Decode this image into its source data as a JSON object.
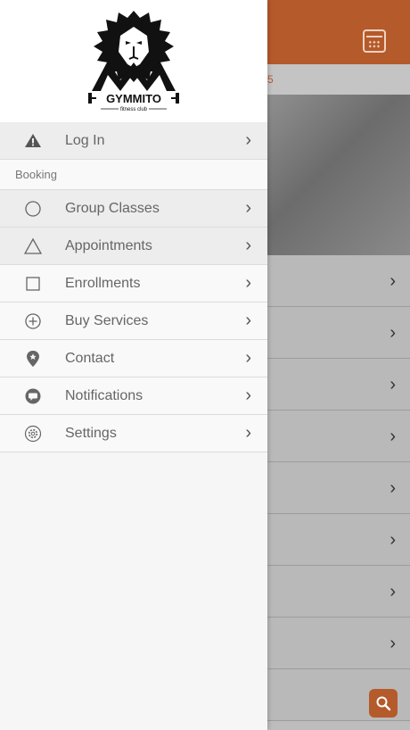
{
  "background": {
    "date_fragment": "5",
    "rows_count_visible": 8
  },
  "brand": {
    "name": "GYMMITO",
    "tagline": "fitness club"
  },
  "menu": {
    "login": {
      "label": "Log In"
    },
    "section_booking": "Booking",
    "items": [
      {
        "label": "Group Classes",
        "icon": "circle-icon"
      },
      {
        "label": "Appointments",
        "icon": "triangle-icon"
      },
      {
        "label": "Enrollments",
        "icon": "square-icon"
      },
      {
        "label": "Buy Services",
        "icon": "plus-circle-icon"
      },
      {
        "label": "Contact",
        "icon": "location-pin-icon"
      },
      {
        "label": "Notifications",
        "icon": "chat-bubble-icon"
      },
      {
        "label": "Settings",
        "icon": "gear-icon"
      }
    ]
  },
  "colors": {
    "accent": "#b55a2a",
    "drawer_bg": "#f6f6f6"
  }
}
